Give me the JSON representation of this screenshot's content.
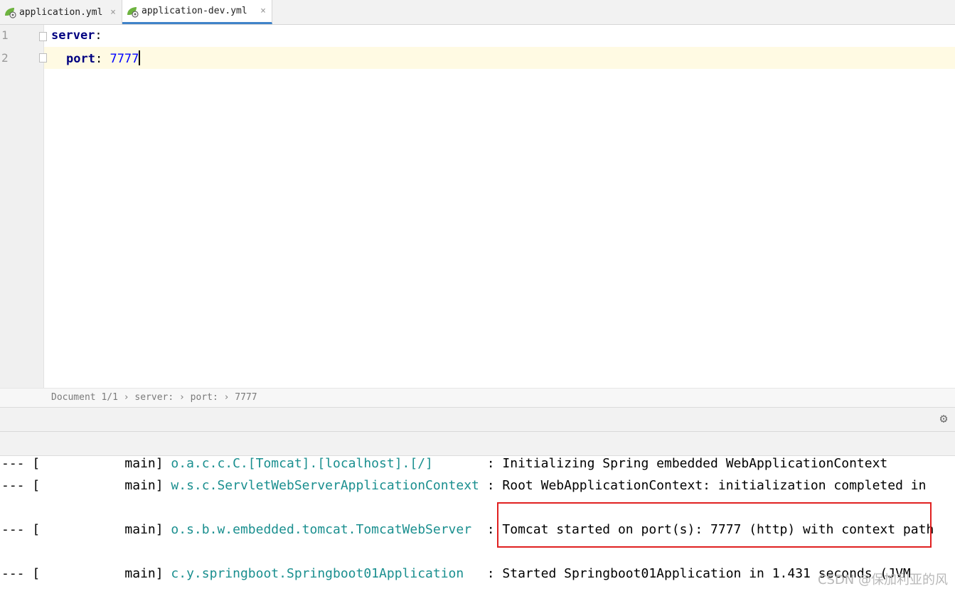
{
  "tabs": [
    {
      "label": "application.yml",
      "icon": "spring-leaf-icon",
      "active": false
    },
    {
      "label": "application-dev.yml",
      "icon": "spring-leaf-icon",
      "active": true
    }
  ],
  "tab_close_glyph": "×",
  "editor": {
    "line_numbers": [
      "1",
      "2"
    ],
    "lines": [
      {
        "key": "server",
        "colon": ":",
        "value": ""
      },
      {
        "key": "port",
        "colon": ":",
        "value": "7777"
      }
    ]
  },
  "breadcrumb": "Document 1/1 › server: › port: › 7777",
  "console": {
    "lines": [
      {
        "prefix": "--- [           main] ",
        "logger": "o.a.c.c.C.[Tomcat].[localhost].[/]      ",
        "message": " : Initializing Spring embedded WebApplicationContext"
      },
      {
        "prefix": "--- [           main] ",
        "logger": "w.s.c.ServletWebServerApplicationContext",
        "message": " : Root WebApplicationContext: initialization completed in"
      },
      {
        "prefix": "--- [           main] ",
        "logger": "o.s.b.w.embedded.tomcat.TomcatWebServer ",
        "message": " : Tomcat started on port(s): 7777 (http) with context path"
      },
      {
        "prefix": "--- [           main] ",
        "logger": "c.y.springboot.Springboot01Application  ",
        "message": " : Started Springboot01Application in 1.431 seconds (JVM"
      }
    ]
  },
  "watermark": "CSDN @保加利亚的风",
  "colors": {
    "accent_tab": "#4083c9",
    "highlight_box": "#e02020",
    "logger": "#1a8f8f",
    "current_line": "#fffae3"
  }
}
